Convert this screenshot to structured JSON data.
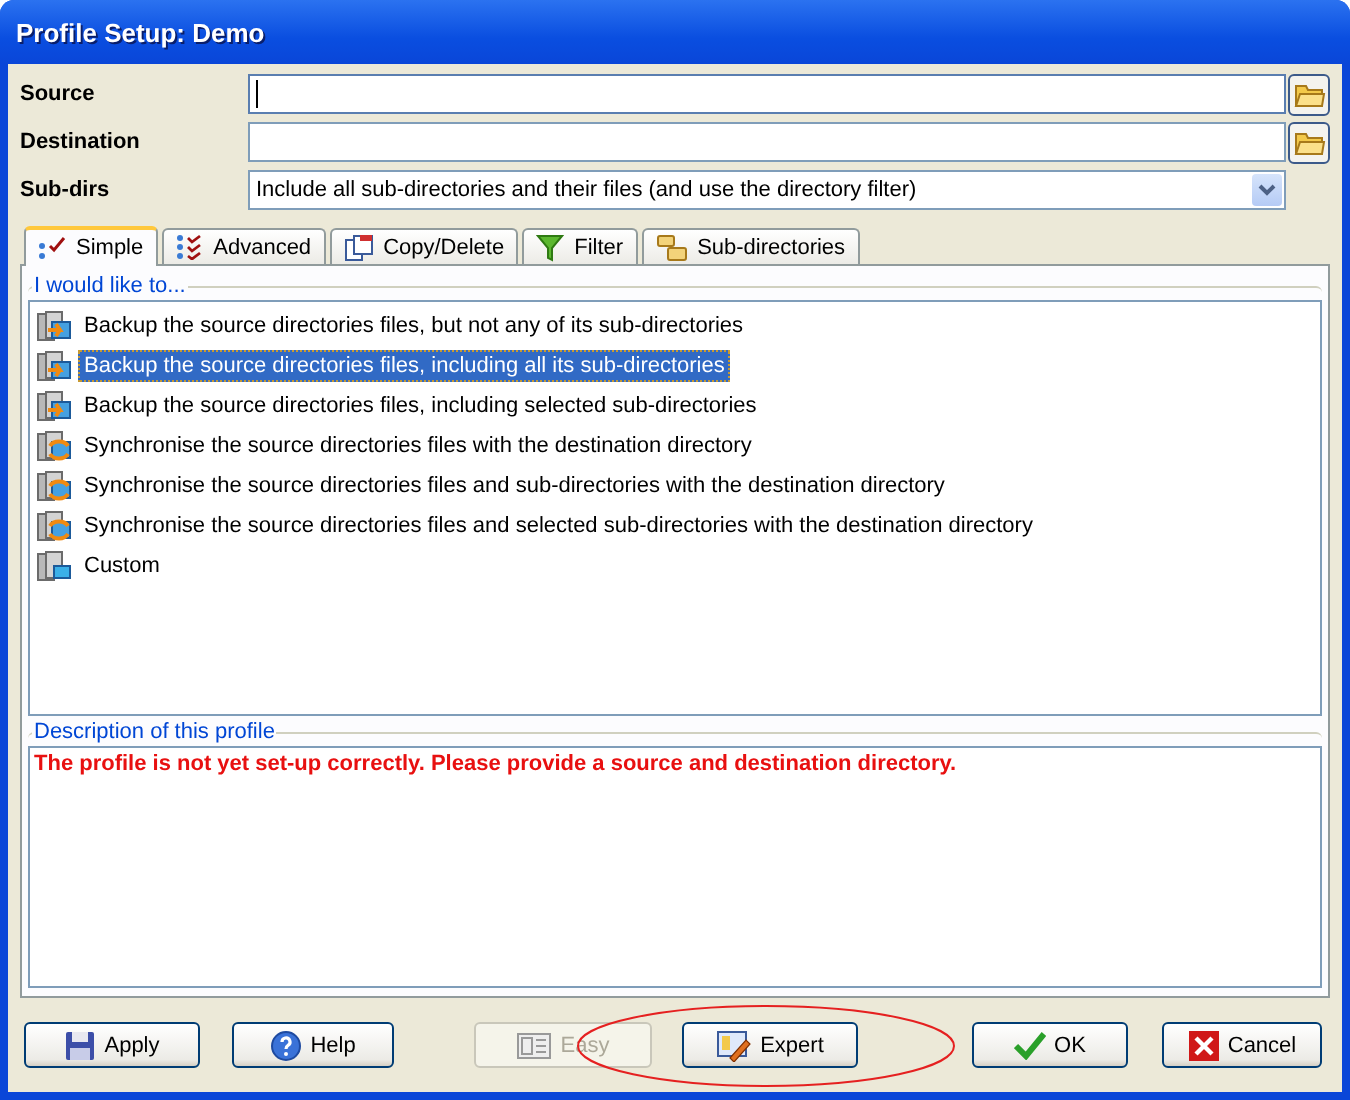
{
  "window": {
    "title": "Profile Setup: Demo"
  },
  "fields": [
    {
      "label": "Source",
      "kind": "path",
      "focused": true
    },
    {
      "label": "Destination",
      "kind": "path",
      "focused": false
    },
    {
      "label": "Sub-dirs",
      "kind": "dropdown",
      "value": "Include all sub-directories and their files (and use the directory filter)",
      "focused": false
    }
  ],
  "tabs": [
    {
      "label": "Simple",
      "selected": true
    },
    {
      "label": "Advanced",
      "selected": false
    },
    {
      "label": "Copy/Delete",
      "selected": false
    },
    {
      "label": "Filter",
      "selected": false
    },
    {
      "label": "Sub-directories",
      "selected": false
    }
  ],
  "options_group": {
    "title": "I would like to...",
    "items": [
      {
        "label": "Backup the source directories files, but not any of its sub-directories",
        "kind": "backup",
        "selected": false
      },
      {
        "label": "Backup the source directories files, including all its sub-directories",
        "kind": "backup",
        "selected": true
      },
      {
        "label": "Backup the source directories files, including selected sub-directories",
        "kind": "backup",
        "selected": false
      },
      {
        "label": "Synchronise the source directories files with the destination directory",
        "kind": "sync",
        "selected": false
      },
      {
        "label": "Synchronise the source directories files and sub-directories with the destination directory",
        "kind": "sync",
        "selected": false
      },
      {
        "label": "Synchronise the source directories files and selected sub-directories with the destination directory",
        "kind": "sync",
        "selected": false
      },
      {
        "label": "Custom",
        "kind": "custom",
        "selected": false
      }
    ]
  },
  "description_group": {
    "title": "Description of this profile",
    "message": "The profile is not yet set-up correctly. Please provide a source and destination directory."
  },
  "buttons": [
    {
      "label": "Apply",
      "disabled": false
    },
    {
      "label": "Help",
      "disabled": false
    },
    {
      "label": "Easy",
      "disabled": true
    },
    {
      "label": "Expert",
      "disabled": false
    },
    {
      "label": "OK",
      "disabled": false
    },
    {
      "label": "Cancel",
      "disabled": false
    }
  ],
  "annotation": {
    "kind": "ellipse"
  }
}
